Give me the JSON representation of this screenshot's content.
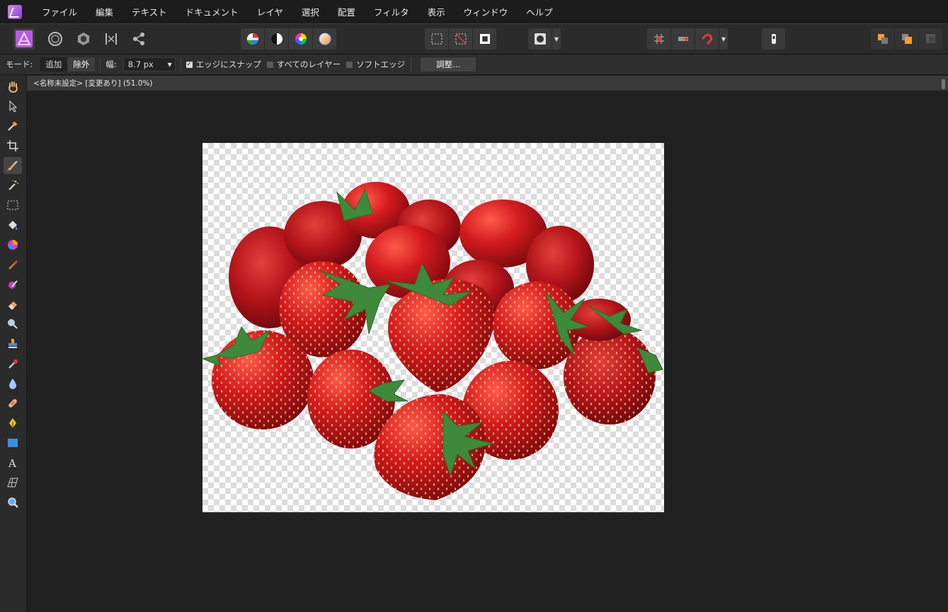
{
  "menu": {
    "items": [
      "ファイル",
      "編集",
      "テキスト",
      "ドキュメント",
      "レイヤ",
      "選択",
      "配置",
      "フィルタ",
      "表示",
      "ウィンドウ",
      "ヘルプ"
    ]
  },
  "context": {
    "mode_label": "モード:",
    "mode_add": "追加",
    "mode_remove": "除外",
    "width_label": "幅:",
    "width_value": "8.7 px",
    "snap_edges": "エッジにスナップ",
    "all_layers": "すべてのレイヤー",
    "soft_edge": "ソフトエッジ",
    "adjust_button": "調整...",
    "snap_checked": true,
    "all_layers_checked": false,
    "soft_edge_checked": false
  },
  "document": {
    "tab_title": "<名称未設定> [変更あり] (51.0%)"
  },
  "colors": {
    "accent_purple": "#b45be0",
    "strawberry": "#c4161c",
    "leaf": "#3f8a3a"
  }
}
